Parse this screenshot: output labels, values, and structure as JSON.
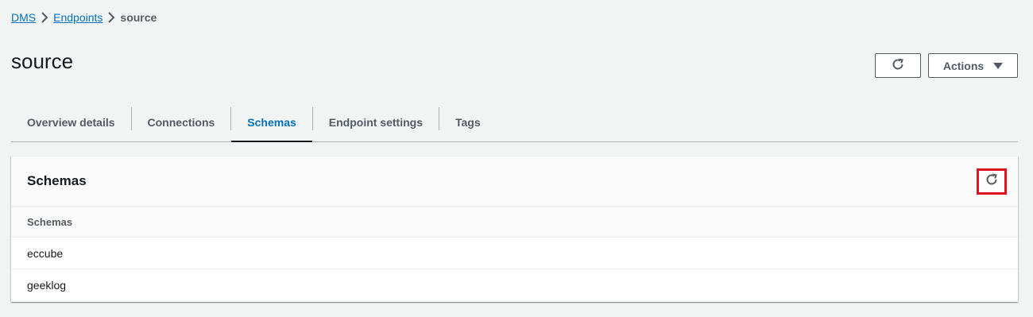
{
  "breadcrumb": {
    "items": [
      "DMS",
      "Endpoints"
    ],
    "current": "source"
  },
  "page": {
    "title": "source"
  },
  "header_actions": {
    "actions_label": "Actions"
  },
  "tabs": [
    {
      "label": "Overview details",
      "active": false
    },
    {
      "label": "Connections",
      "active": false
    },
    {
      "label": "Schemas",
      "active": true
    },
    {
      "label": "Endpoint settings",
      "active": false
    },
    {
      "label": "Tags",
      "active": false
    }
  ],
  "panel": {
    "title": "Schemas",
    "column_header": "Schemas",
    "rows": [
      "eccube",
      "geeklog"
    ]
  },
  "icons": {
    "refresh": "refresh-icon",
    "caret": "caret-down-icon",
    "chevron": "chevron-right-icon"
  },
  "colors": {
    "link": "#0073bb",
    "highlight_border": "#e0141e",
    "background": "#f2f3f3"
  }
}
